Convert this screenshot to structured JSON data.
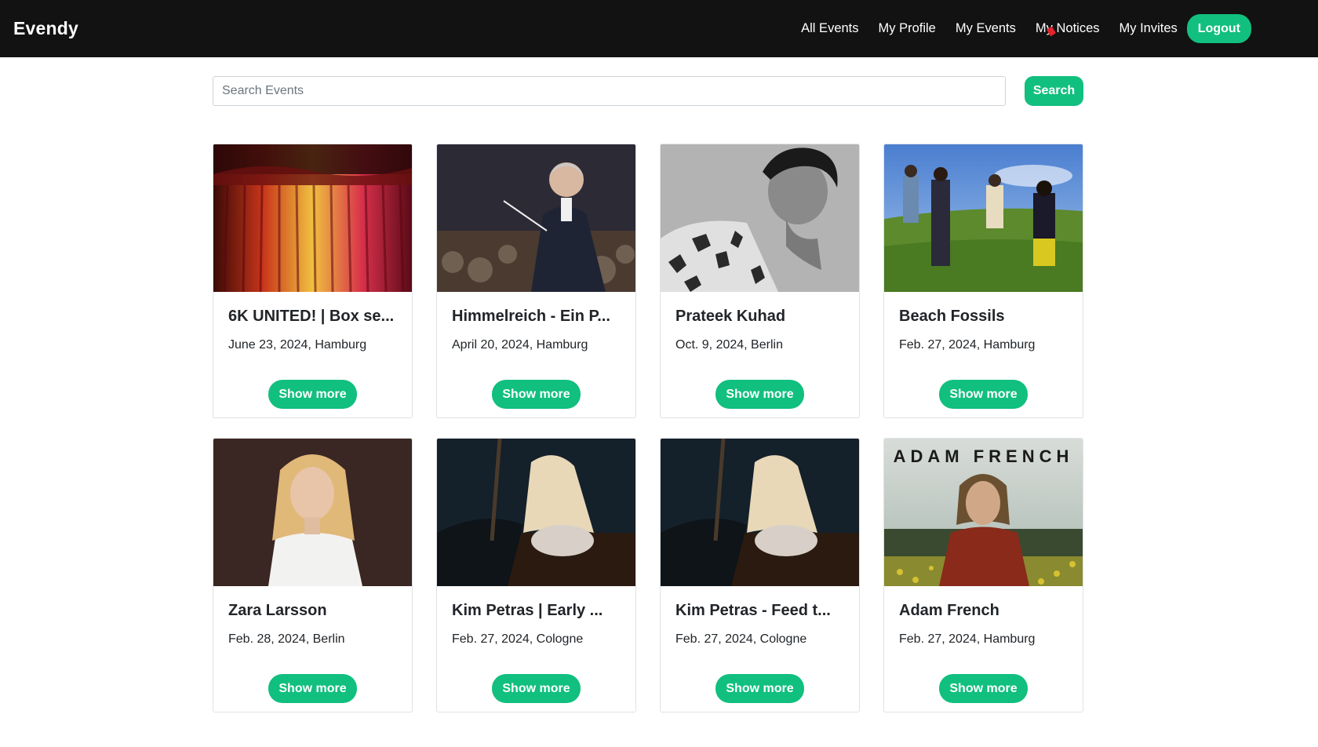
{
  "nav": {
    "brand": "Evendy",
    "links": [
      {
        "label": "All Events"
      },
      {
        "label": "My Profile"
      },
      {
        "label": "My Events"
      },
      {
        "label": "My Notices"
      },
      {
        "label": "My Invites"
      }
    ],
    "logout_label": "Logout"
  },
  "search": {
    "placeholder": "Search Events",
    "button_label": "Search"
  },
  "events": [
    {
      "title": "6K UNITED! | Box se...",
      "subtitle": "June 23, 2024, Hamburg",
      "button": "Show more"
    },
    {
      "title": "Himmelreich - Ein P...",
      "subtitle": "April 20, 2024, Hamburg",
      "button": "Show more"
    },
    {
      "title": "Prateek Kuhad",
      "subtitle": "Oct. 9, 2024, Berlin",
      "button": "Show more"
    },
    {
      "title": "Beach Fossils",
      "subtitle": "Feb. 27, 2024, Hamburg",
      "button": "Show more"
    },
    {
      "title": "Zara Larsson",
      "subtitle": "Feb. 28, 2024, Berlin",
      "button": "Show more"
    },
    {
      "title": "Kim Petras | Early ...",
      "subtitle": "Feb. 27, 2024, Cologne",
      "button": "Show more"
    },
    {
      "title": "Kim Petras - Feed t...",
      "subtitle": "Feb. 27, 2024, Cologne",
      "button": "Show more"
    },
    {
      "title": "Adam French",
      "subtitle": "Feb. 27, 2024, Hamburg",
      "button": "Show more",
      "image_text": "ADAM FRENCH"
    }
  ],
  "colors": {
    "accent": "#11bf7f",
    "navbar": "#121212"
  }
}
